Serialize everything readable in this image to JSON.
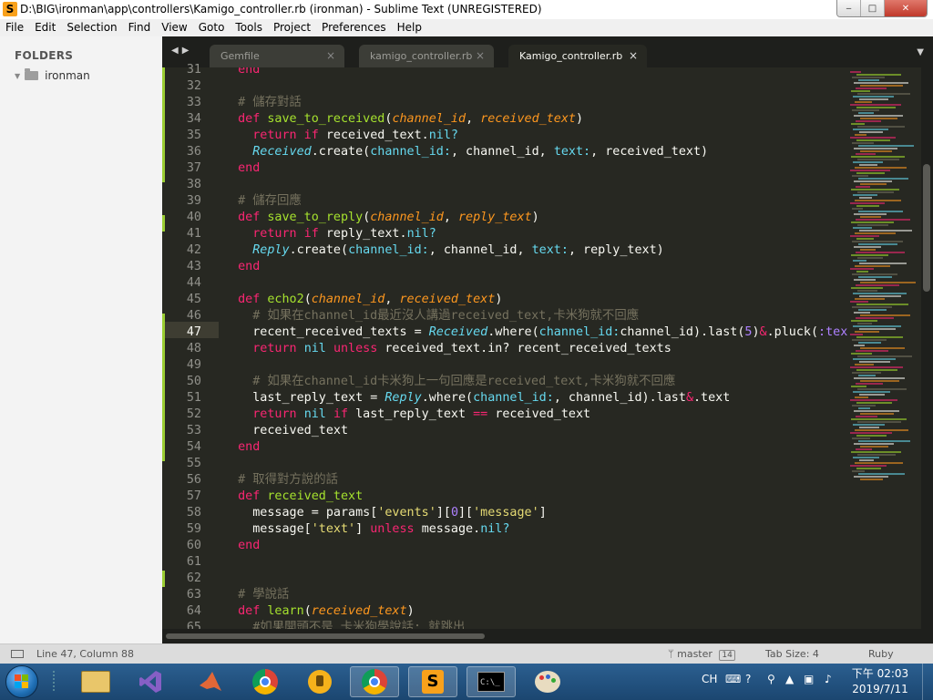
{
  "window": {
    "title": "D:\\BIG\\ironman\\app\\controllers\\Kamigo_controller.rb (ironman) - Sublime Text (UNREGISTERED)",
    "min": "‒",
    "max": "□",
    "close": "✕"
  },
  "menu": [
    "File",
    "Edit",
    "Selection",
    "Find",
    "View",
    "Goto",
    "Tools",
    "Project",
    "Preferences",
    "Help"
  ],
  "sidebar": {
    "header": "FOLDERS",
    "folder": "ironman"
  },
  "tabs": [
    {
      "label": "Gemfile",
      "active": false
    },
    {
      "label": "kamigo_controller.rb",
      "active": false
    },
    {
      "label": "Kamigo_controller.rb",
      "active": true
    }
  ],
  "editor": {
    "line_numbers": [
      "31",
      "32",
      "33",
      "34",
      "35",
      "36",
      "37",
      "38",
      "39",
      "40",
      "41",
      "42",
      "43",
      "44",
      "45",
      "46",
      "47",
      "48",
      "49",
      "50",
      "51",
      "52",
      "53",
      "54",
      "55",
      "56",
      "57",
      "58",
      "59",
      "60",
      "61",
      "62",
      "63",
      "64",
      "65"
    ],
    "lines": [
      [
        [
          "k",
          "  end"
        ]
      ],
      [],
      [
        [
          "c",
          "  # 儲存對話"
        ]
      ],
      [
        [
          "k",
          "  def "
        ],
        [
          "f",
          "save_to_received"
        ],
        [
          "",
          "("
        ],
        [
          "p",
          "channel_id"
        ],
        [
          "",
          ", "
        ],
        [
          "p",
          "received_text"
        ],
        [
          "",
          ")"
        ]
      ],
      [
        [
          "k",
          "    return if "
        ],
        [
          "",
          "received_text."
        ],
        [
          "b",
          "nil?"
        ]
      ],
      [
        [
          "cl-name",
          "    Received"
        ],
        [
          "",
          ".create("
        ],
        [
          "b",
          "channel_id:"
        ],
        [
          "",
          ", channel_id, "
        ],
        [
          "b",
          "text:"
        ],
        [
          "",
          ", received_text)"
        ]
      ],
      [
        [
          "k",
          "  end"
        ]
      ],
      [],
      [
        [
          "c",
          "  # 儲存回應"
        ]
      ],
      [
        [
          "k",
          "  def "
        ],
        [
          "f",
          "save_to_reply"
        ],
        [
          "",
          "("
        ],
        [
          "p",
          "channel_id"
        ],
        [
          "",
          ", "
        ],
        [
          "p",
          "reply_text"
        ],
        [
          "",
          ")"
        ]
      ],
      [
        [
          "k",
          "    return if "
        ],
        [
          "",
          "reply_text."
        ],
        [
          "b",
          "nil?"
        ]
      ],
      [
        [
          "cl-name",
          "    Reply"
        ],
        [
          "",
          ".create("
        ],
        [
          "b",
          "channel_id:"
        ],
        [
          "",
          ", channel_id, "
        ],
        [
          "b",
          "text:"
        ],
        [
          "",
          ", reply_text)"
        ]
      ],
      [
        [
          "k",
          "  end"
        ]
      ],
      [],
      [
        [
          "k",
          "  def "
        ],
        [
          "f",
          "echo2"
        ],
        [
          "",
          "("
        ],
        [
          "p",
          "channel_id"
        ],
        [
          "",
          ", "
        ],
        [
          "p",
          "received_text"
        ],
        [
          "",
          ")"
        ]
      ],
      [
        [
          "c",
          "    # 如果在channel_id最近沒人講過received_text,卡米狗就不回應"
        ]
      ],
      [
        [
          "",
          "    recent_received_texts = "
        ],
        [
          "cl-name",
          "Received"
        ],
        [
          "",
          ".where("
        ],
        [
          "b",
          "channel_id:"
        ],
        [
          "",
          "channel_id).last("
        ],
        [
          "n",
          "5"
        ],
        [
          "",
          ")"
        ],
        [
          "k",
          "&"
        ],
        [
          "",
          ".pluck("
        ],
        [
          "sy",
          ":text"
        ],
        [
          "",
          ")"
        ]
      ],
      [
        [
          "k",
          "    return "
        ],
        [
          "b",
          "nil "
        ],
        [
          "k",
          "unless "
        ],
        [
          "",
          "received_text.in? recent_received_texts"
        ]
      ],
      [],
      [
        [
          "c",
          "    # 如果在channel_id卡米狗上一句回應是received_text,卡米狗就不回應"
        ]
      ],
      [
        [
          "",
          "    last_reply_text = "
        ],
        [
          "cl-name",
          "Reply"
        ],
        [
          "",
          ".where("
        ],
        [
          "b",
          "channel_id:"
        ],
        [
          "",
          ", channel_id).last"
        ],
        [
          "k",
          "&"
        ],
        [
          "",
          ".text"
        ]
      ],
      [
        [
          "k",
          "    return "
        ],
        [
          "b",
          "nil "
        ],
        [
          "k",
          "if "
        ],
        [
          "",
          "last_reply_text "
        ],
        [
          "k",
          "== "
        ],
        [
          "",
          "received_text"
        ]
      ],
      [
        [
          "",
          "    received_text"
        ]
      ],
      [
        [
          "k",
          "  end"
        ]
      ],
      [],
      [
        [
          "c",
          "  # 取得對方說的話"
        ]
      ],
      [
        [
          "k",
          "  def "
        ],
        [
          "f",
          "received_text"
        ]
      ],
      [
        [
          "",
          "    message = params["
        ],
        [
          "s",
          "'events'"
        ],
        [
          "",
          "]["
        ],
        [
          "n",
          "0"
        ],
        [
          "",
          "]["
        ],
        [
          "s",
          "'message'"
        ],
        [
          "",
          "]"
        ]
      ],
      [
        [
          "",
          "    message["
        ],
        [
          "s",
          "'text'"
        ],
        [
          "",
          "] "
        ],
        [
          "k",
          "unless "
        ],
        [
          "",
          "message."
        ],
        [
          "b",
          "nil?"
        ]
      ],
      [
        [
          "k",
          "  end"
        ]
      ],
      [],
      [],
      [
        [
          "c",
          "  # 學說話"
        ]
      ],
      [
        [
          "k",
          "  def "
        ],
        [
          "f",
          "learn"
        ],
        [
          "",
          "("
        ],
        [
          "p",
          "received_text"
        ],
        [
          "",
          ")"
        ]
      ],
      [
        [
          "c",
          "    #如果開頭不是 卡米狗學說話; 就跳出"
        ]
      ]
    ]
  },
  "status": {
    "position": "Line 47, Column 88",
    "branch": "master",
    "branch_count": "14",
    "tab_size": "Tab Size: 4",
    "syntax": "Ruby"
  },
  "tray": {
    "lang": "CH",
    "time": "下午 02:03",
    "date": "2019/7/11"
  },
  "colors": {
    "keyword": "#f92672",
    "function": "#a6e22e",
    "param": "#fd971f",
    "comment": "#75715e",
    "builtin": "#66d9ef",
    "string": "#e6db74",
    "number": "#ae81ff",
    "bg": "#272822"
  },
  "icons": {
    "app": "sublime-icon",
    "folder": "folder-icon",
    "branch": "git-branch-icon",
    "panel": "panel-icon"
  }
}
